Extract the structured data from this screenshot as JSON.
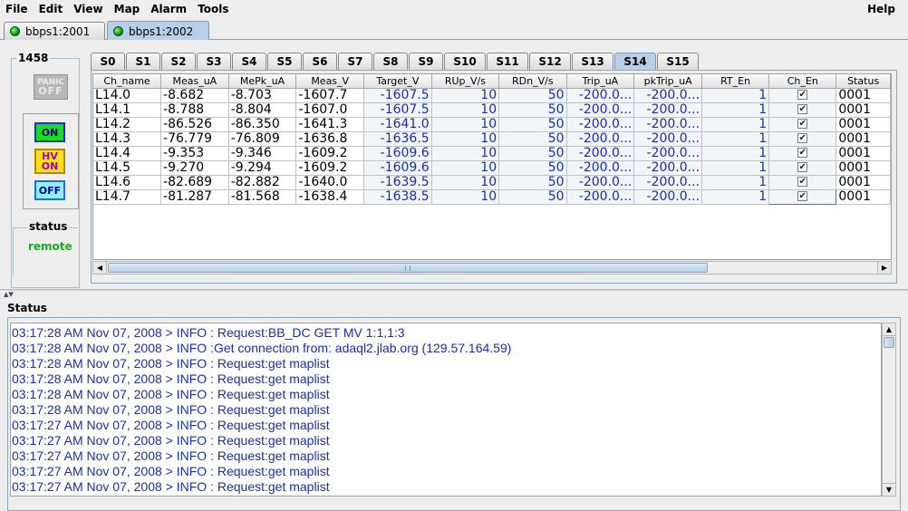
{
  "menu": [
    "File",
    "Edit",
    "View",
    "Map",
    "Alarm",
    "Tools"
  ],
  "help": "Help",
  "hosts": [
    {
      "label": "bbps1:2001",
      "selected": false
    },
    {
      "label": "bbps1:2002",
      "selected": true
    }
  ],
  "crate": {
    "number": "1458",
    "panic_top": "PANIC",
    "panic_bottom": "OFF",
    "on_label": "ON",
    "hv_top": "HV",
    "hv_bottom": "ON",
    "off_label": "OFF",
    "status_title": "status",
    "status_value": "remote"
  },
  "slots": [
    "S0",
    "S1",
    "S2",
    "S3",
    "S4",
    "S5",
    "S6",
    "S7",
    "S8",
    "S9",
    "S10",
    "S11",
    "S12",
    "S13",
    "S14",
    "S15"
  ],
  "selected_slot": "S14",
  "table": {
    "headers": [
      "Ch_name",
      "Meas_uA",
      "MePk_uA",
      "Meas_V",
      "Target_V",
      "RUp_V/s",
      "RDn_V/s",
      "Trip_uA",
      "pkTrip_uA",
      "RT_En",
      "Ch_En",
      "Status"
    ],
    "rows": [
      [
        "L14.0",
        "-8.682",
        "-8.703",
        "-1607.7",
        "-1607.5",
        "10",
        "50",
        "-200.0...",
        "-200.0...",
        "1",
        "✔",
        "0001"
      ],
      [
        "L14.1",
        "-8.788",
        "-8.804",
        "-1607.0",
        "-1607.5",
        "10",
        "50",
        "-200.0...",
        "-200.0...",
        "1",
        "✔",
        "0001"
      ],
      [
        "L14.2",
        "-86.526",
        "-86.350",
        "-1641.3",
        "-1641.0",
        "10",
        "50",
        "-200.0...",
        "-200.0...",
        "1",
        "✔",
        "0001"
      ],
      [
        "L14.3",
        "-76.779",
        "-76.809",
        "-1636.8",
        "-1636.5",
        "10",
        "50",
        "-200.0...",
        "-200.0...",
        "1",
        "✔",
        "0001"
      ],
      [
        "L14.4",
        "-9.353",
        "-9.346",
        "-1609.2",
        "-1609.6",
        "10",
        "50",
        "-200.0...",
        "-200.0...",
        "1",
        "✔",
        "0001"
      ],
      [
        "L14.5",
        "-9.270",
        "-9.294",
        "-1609.2",
        "-1609.6",
        "10",
        "50",
        "-200.0...",
        "-200.0...",
        "1",
        "✔",
        "0001"
      ],
      [
        "L14.6",
        "-82.689",
        "-82.882",
        "-1640.0",
        "-1639.5",
        "10",
        "50",
        "-200.0...",
        "-200.0...",
        "1",
        "✔",
        "0001"
      ],
      [
        "L14.7",
        "-81.287",
        "-81.568",
        "-1638.4",
        "-1638.5",
        "10",
        "50",
        "-200.0...",
        "-200.0...",
        "1",
        "✔",
        "0001"
      ]
    ]
  },
  "status_panel": {
    "title": "Status",
    "lines": [
      "03:17:28 AM Nov 07, 2008 > INFO : Request:BB_DC GET MV 1:1,1:3",
      "03:17:28 AM Nov 07, 2008 > INFO :Get connection from: adaql2.jlab.org (129.57.164.59)",
      "03:17:28 AM Nov 07, 2008 > INFO : Request:get maplist",
      "03:17:28 AM Nov 07, 2008 > INFO : Request:get maplist",
      "03:17:28 AM Nov 07, 2008 > INFO : Request:get maplist",
      "03:17:28 AM Nov 07, 2008 > INFO : Request:get maplist",
      "03:17:27 AM Nov 07, 2008 > INFO : Request:get maplist",
      "03:17:27 AM Nov 07, 2008 > INFO : Request:get maplist",
      "03:17:27 AM Nov 07, 2008 > INFO : Request:get maplist",
      "03:17:27 AM Nov 07, 2008 > INFO : Request:get maplist",
      "03:17:27 AM Nov 07, 2008 > INFO : Request:get maplist"
    ]
  }
}
